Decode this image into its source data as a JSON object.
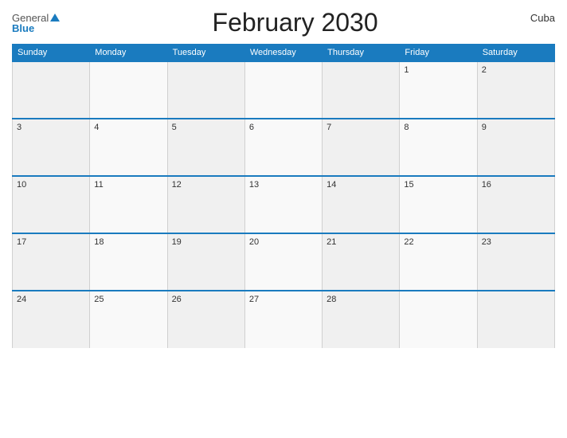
{
  "header": {
    "title": "February 2030",
    "country": "Cuba",
    "logo_general": "General",
    "logo_blue": "Blue"
  },
  "weekdays": [
    "Sunday",
    "Monday",
    "Tuesday",
    "Wednesday",
    "Thursday",
    "Friday",
    "Saturday"
  ],
  "weeks": [
    [
      null,
      null,
      null,
      null,
      null,
      1,
      2
    ],
    [
      3,
      4,
      5,
      6,
      7,
      8,
      9
    ],
    [
      10,
      11,
      12,
      13,
      14,
      15,
      16
    ],
    [
      17,
      18,
      19,
      20,
      21,
      22,
      23
    ],
    [
      24,
      25,
      26,
      27,
      28,
      null,
      null
    ]
  ]
}
